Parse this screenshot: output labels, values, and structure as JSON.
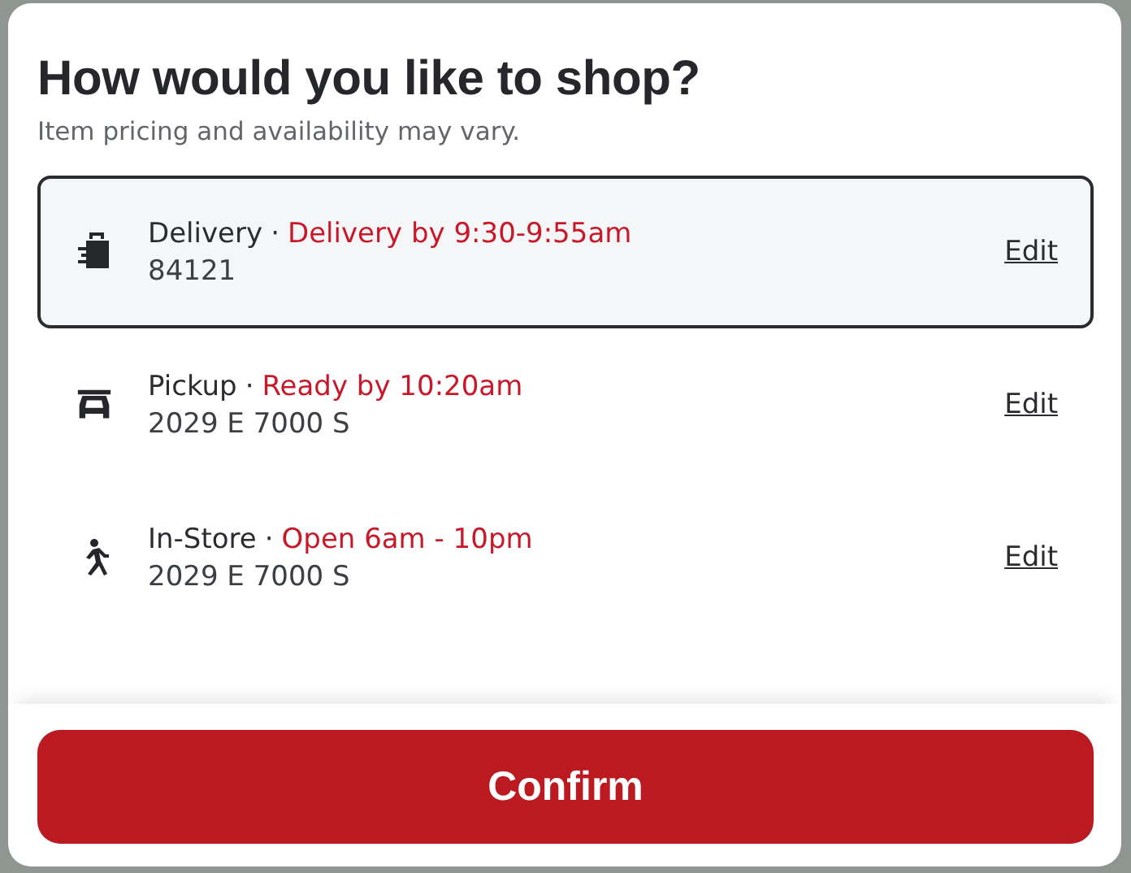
{
  "dialog": {
    "title": "How would you like to shop?",
    "subtitle": "Item pricing and availability may vary.",
    "options": [
      {
        "kind": "delivery",
        "name": "Delivery",
        "separator": "·",
        "status": "Delivery by 9:30-9:55am",
        "detail": "84121",
        "action": "Edit",
        "selected": true
      },
      {
        "kind": "pickup",
        "name": "Pickup",
        "separator": "·",
        "status": "Ready by 10:20am",
        "detail": "2029 E 7000 S",
        "action": "Edit",
        "selected": false
      },
      {
        "kind": "instore",
        "name": "In-Store",
        "separator": "·",
        "status": "Open 6am - 10pm",
        "detail": "2029 E 7000 S",
        "action": "Edit",
        "selected": false
      }
    ],
    "confirm": "Confirm"
  }
}
